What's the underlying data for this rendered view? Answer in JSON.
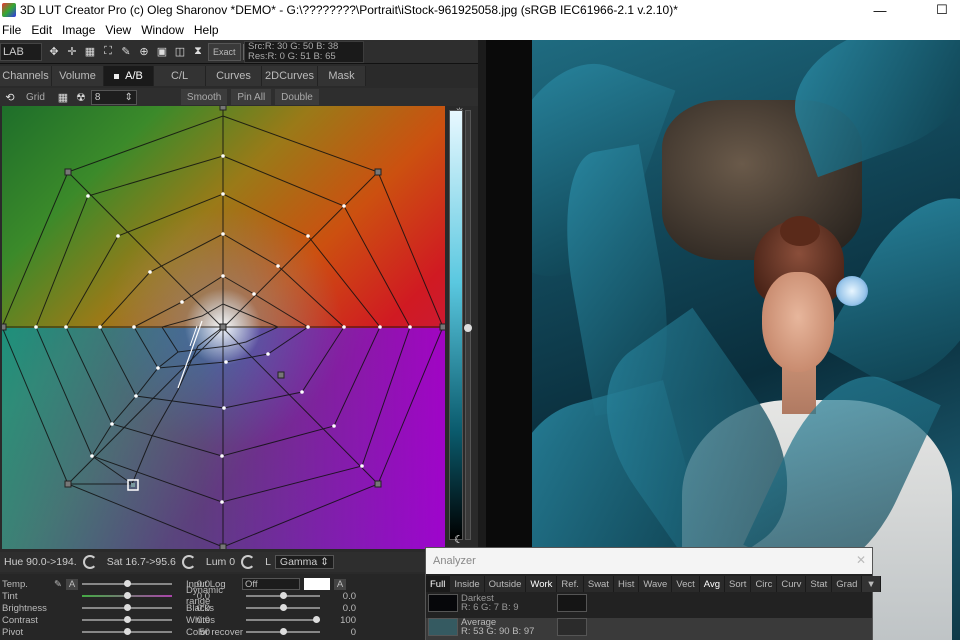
{
  "window": {
    "title": "3D LUT Creator Pro (c) Oleg Sharonov *DEMO* - G:\\????????\\Portrait\\iStock-961925058.jpg (sRGB IEC61966-2.1 v.2.10)*",
    "minimize": "—",
    "maximize": "☐"
  },
  "menu": [
    "File",
    "Edit",
    "Image",
    "View",
    "Window",
    "Help"
  ],
  "toolbar": {
    "color_space": "LAB",
    "exact_label": "Exact",
    "src_readout": "Src:R: 30  G: 50  B: 38",
    "res_readout": "Res:R: 0   G: 51  B: 65"
  },
  "tabs": [
    {
      "label": "Channels",
      "active": false
    },
    {
      "label": "Volume",
      "active": false
    },
    {
      "label": "A/B",
      "active": true
    },
    {
      "label": "C/L",
      "active": false
    },
    {
      "label": "Curves",
      "active": false
    },
    {
      "label": "2DCurves",
      "active": false
    },
    {
      "label": "Mask",
      "active": false
    }
  ],
  "grid_bar": {
    "grid_label": "Grid",
    "grid_value": "8",
    "smooth_label": "Smooth",
    "pin_all_label": "Pin All",
    "double_label": "Double"
  },
  "status": {
    "hue": "Hue 90.0->194.",
    "sat": "Sat 16.7->95.6",
    "lum": "Lum 0",
    "gamma_prefix": "L",
    "gamma": "Gamma"
  },
  "adjustments_left": [
    {
      "label": "Temp.",
      "value": "0.0",
      "pos": 0.5
    },
    {
      "label": "Tint",
      "value": "0.0",
      "pos": 0.5
    },
    {
      "label": "Brightness",
      "value": "0.0",
      "pos": 0.5
    },
    {
      "label": "Contrast",
      "value": "0.0",
      "pos": 0.5
    },
    {
      "label": "Pivot",
      "value": "50",
      "pos": 0.5
    }
  ],
  "adjustments_right": [
    {
      "label": "Input Log",
      "value": "Off"
    },
    {
      "label": "Dynamic range",
      "value": "0.0",
      "pos": 0.5
    },
    {
      "label": "Blacks",
      "value": "0.0",
      "pos": 0.5
    },
    {
      "label": "Whites",
      "value": "100",
      "pos": 1.0
    },
    {
      "label": "Color recover",
      "value": "0",
      "pos": 0.5
    }
  ],
  "analyzer": {
    "title": "Analyzer",
    "close": "✕",
    "tabs": [
      "Full",
      "Inside",
      "Outside",
      "Work",
      "Ref.",
      "Swat",
      "Hist",
      "Wave",
      "Vect",
      "Avg",
      "Sort",
      "Circ",
      "Curv",
      "Stat",
      "Grad"
    ],
    "active_tab": "Full",
    "rows": [
      {
        "name": "Darkest",
        "values": "R: 6   G: 7   B: 9",
        "swatch": "#06070a"
      },
      {
        "name": "Average",
        "values": "R: 53  G: 90  B: 97",
        "swatch": "#355a61"
      }
    ]
  }
}
